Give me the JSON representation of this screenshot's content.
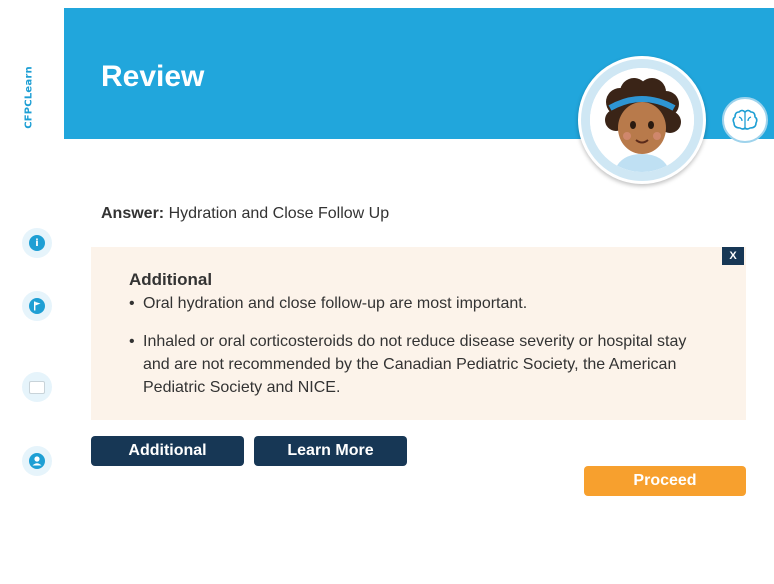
{
  "brand": {
    "name": "CFPCLearn"
  },
  "header": {
    "title": "Review"
  },
  "answer": {
    "label": "Answer:",
    "text": "Hydration and Close Follow Up"
  },
  "panel": {
    "close_label": "X",
    "heading": "Additional",
    "bullets": [
      "Oral hydration and close follow-up are most important.",
      "Inhaled or oral corticosteroids do not reduce disease severity or hospital stay and are not recommended by the Canadian Pediatric Society, the American Pediatric Society and NICE."
    ]
  },
  "buttons": {
    "additional": "Additional",
    "learn_more": "Learn More",
    "proceed": "Proceed"
  },
  "colors": {
    "header": "#21a6dc",
    "dark_button": "#173755",
    "proceed": "#f7a02e",
    "panel_bg": "#fcf3ea"
  },
  "icons": {
    "rail": [
      "info-icon",
      "flag-icon",
      "notes-icon",
      "user-icon"
    ],
    "brain": "brain-icon"
  }
}
